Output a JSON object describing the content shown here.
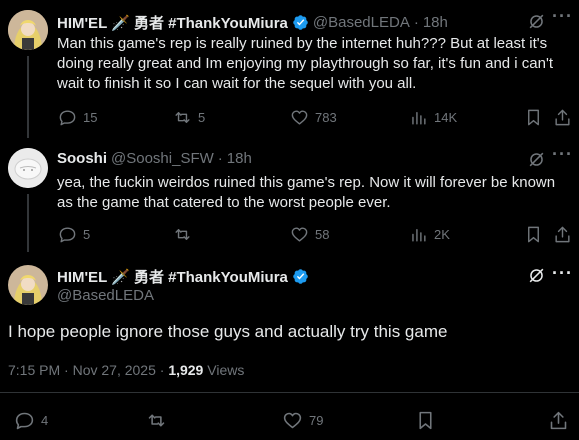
{
  "tweets": [
    {
      "name": "HIM'EL 🗡️ 勇者 #ThankYouMiura",
      "handle": "@BasedLEDA",
      "time": "18h",
      "text": "Man this game's rep is really ruined by the internet huh??? But at least it's doing really great and Im enjoying my playthrough so far, it's fun and i can't wait to finish it so I can wait for the sequel with you all.",
      "replies": "15",
      "reposts": "5",
      "likes": "783",
      "views": "14K"
    },
    {
      "name": "Sooshi",
      "handle": "@Sooshi_SFW",
      "time": "18h",
      "text": "yea, the fuckin weirdos ruined this game's rep. Now it will forever be known as the game that catered to the worst people ever.",
      "replies": "5",
      "reposts": "",
      "likes": "58",
      "views": "2K"
    }
  ],
  "main": {
    "name": "HIM'EL 🗡️ 勇者 #ThankYouMiura",
    "handle": "@BasedLEDA",
    "text": "I hope people ignore those guys and actually try this game",
    "datetime": "7:15 PM · Nov 27, 2025 · ",
    "views_count": "1,929",
    "views_label": " Views",
    "replies": "4",
    "reposts": "",
    "likes": "79"
  },
  "separator": "·",
  "colors": {
    "verified": "#1d9bf0",
    "muted": "#71767b",
    "text": "#e7e9ea"
  }
}
